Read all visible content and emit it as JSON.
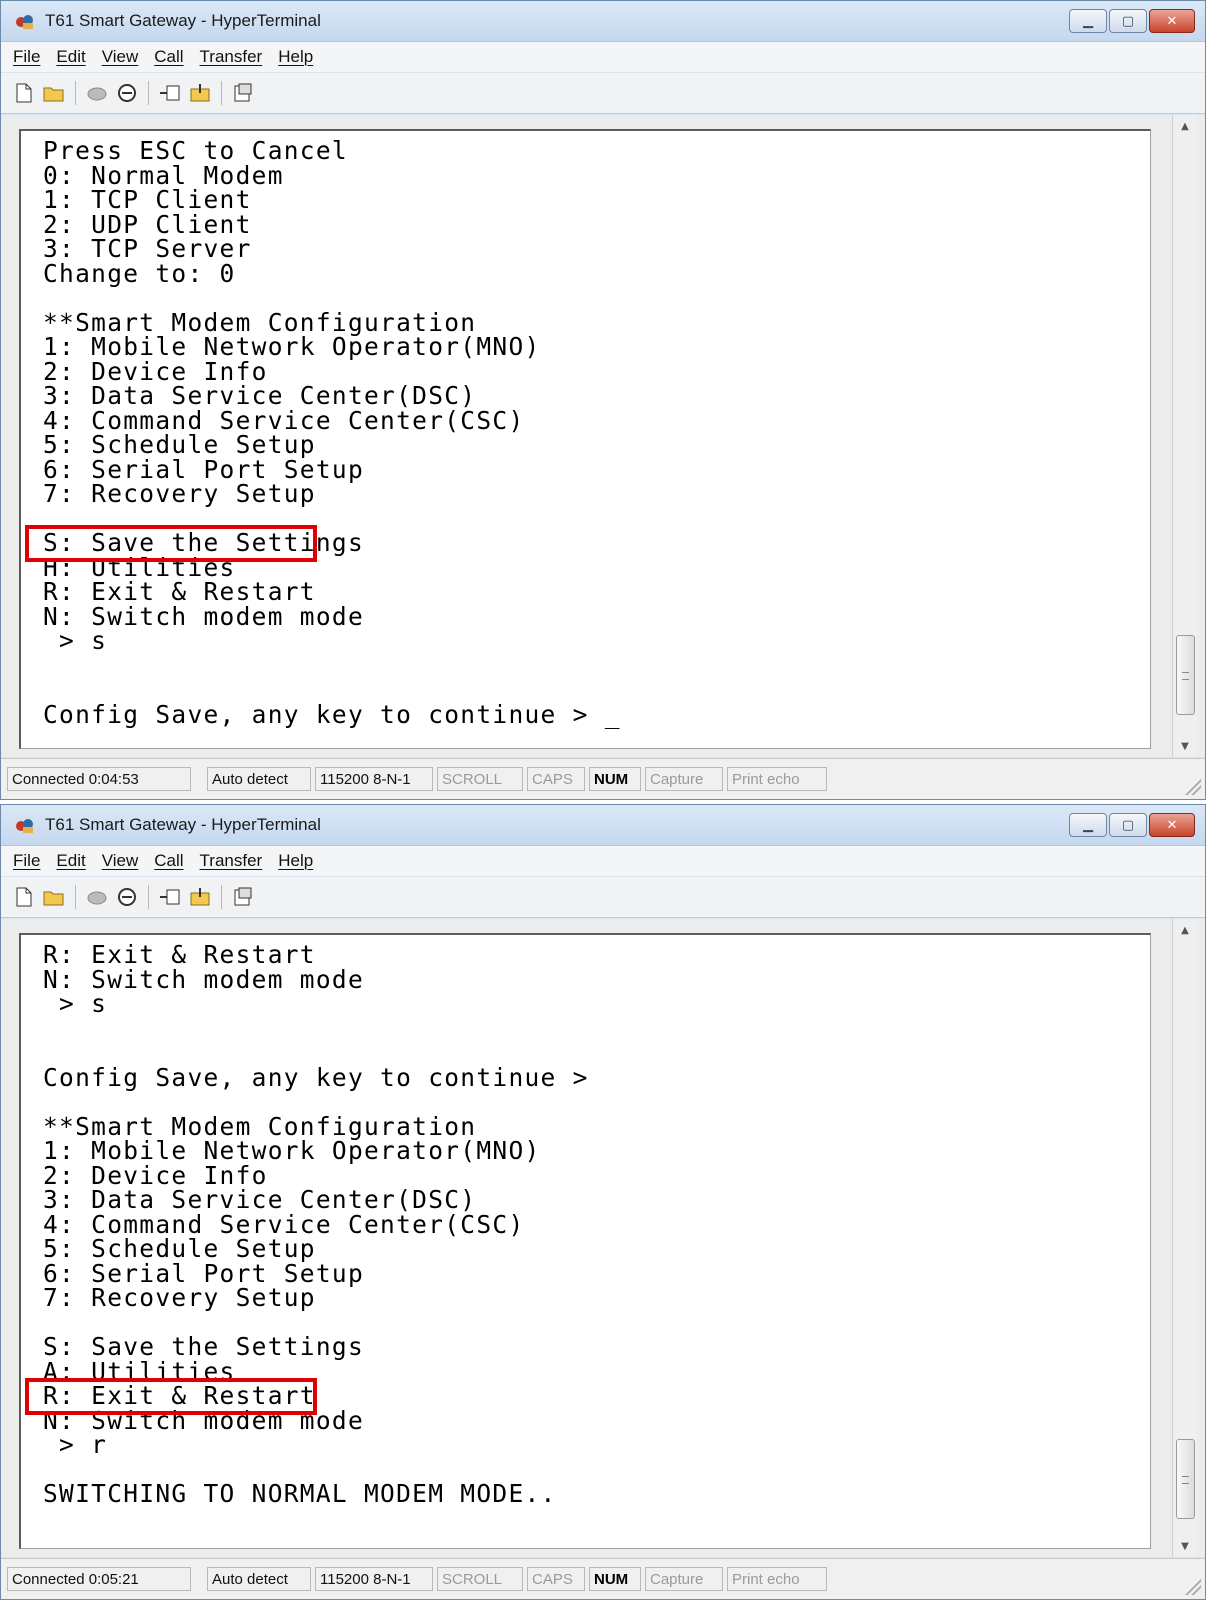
{
  "windows": [
    {
      "title": "T61 Smart Gateway - HyperTerminal",
      "menu": [
        "File",
        "Edit",
        "View",
        "Call",
        "Transfer",
        "Help"
      ],
      "terminal_lines": [
        "Press ESC to Cancel",
        "0: Normal Modem",
        "1: TCP Client",
        "2: UDP Client",
        "3: TCP Server",
        "Change to: 0",
        "",
        "**Smart Modem Configuration",
        "1: Mobile Network Operator(MNO)",
        "2: Device Info",
        "3: Data Service Center(DSC)",
        "4: Command Service Center(CSC)",
        "5: Schedule Setup",
        "6: Serial Port Setup",
        "7: Recovery Setup",
        "",
        "S: Save the Settings",
        "H: Utilities",
        "R: Exit & Restart",
        "N: Switch modem mode",
        " > s",
        "",
        "",
        "Config Save, any key to continue > _"
      ],
      "highlight_line_index": 16,
      "status": {
        "connected": "Connected 0:04:53",
        "detect": "Auto detect",
        "port": "115200 8-N-1",
        "scroll": "SCROLL",
        "caps": "CAPS",
        "num": "NUM",
        "capture": "Capture",
        "print_echo": "Print echo"
      }
    },
    {
      "title": "T61 Smart Gateway - HyperTerminal",
      "menu": [
        "File",
        "Edit",
        "View",
        "Call",
        "Transfer",
        "Help"
      ],
      "terminal_lines": [
        "R: Exit & Restart",
        "N: Switch modem mode",
        " > s",
        "",
        "",
        "Config Save, any key to continue >",
        "",
        "**Smart Modem Configuration",
        "1: Mobile Network Operator(MNO)",
        "2: Device Info",
        "3: Data Service Center(DSC)",
        "4: Command Service Center(CSC)",
        "5: Schedule Setup",
        "6: Serial Port Setup",
        "7: Recovery Setup",
        "",
        "S: Save the Settings",
        "A: Utilities",
        "R: Exit & Restart",
        "N: Switch modem mode",
        " > r",
        "",
        "SWITCHING TO NORMAL MODEM MODE..",
        "",
        "_"
      ],
      "highlight_line_index": 18,
      "status": {
        "connected": "Connected 0:05:21",
        "detect": "Auto detect",
        "port": "115200 8-N-1",
        "scroll": "SCROLL",
        "caps": "CAPS",
        "num": "NUM",
        "capture": "Capture",
        "print_echo": "Print echo"
      }
    }
  ],
  "colors": {
    "highlight": "#e00000",
    "terminal_bg": "#ffffff",
    "terminal_fg": "#000000"
  }
}
